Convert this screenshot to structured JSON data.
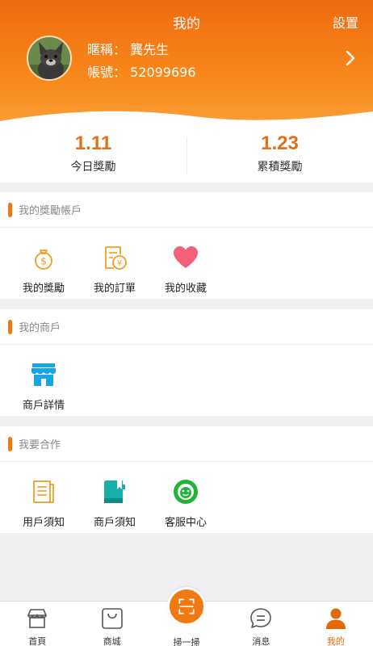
{
  "header": {
    "title": "我的",
    "settings": "設置",
    "nickname": "暱稱：  龔先生",
    "account": "帳號：  52099696"
  },
  "stats": [
    {
      "value": "1.11",
      "label": "今日獎勵"
    },
    {
      "value": "1.23",
      "label": "累積獎勵"
    }
  ],
  "sections": [
    {
      "title": "我的獎勵帳戶",
      "items": [
        "我的獎勵",
        "我的訂單",
        "我的收藏"
      ]
    },
    {
      "title": "我的商戶",
      "items": [
        "商戶詳情"
      ]
    },
    {
      "title": "我要合作",
      "items": [
        "用戶須知",
        "商戶須知",
        "客服中心"
      ]
    }
  ],
  "tabbar": [
    "首頁",
    "商城",
    "掃一掃",
    "消息",
    "我的"
  ],
  "colors": {
    "accent": "#f07a12",
    "accent_text": "#e0701a"
  }
}
